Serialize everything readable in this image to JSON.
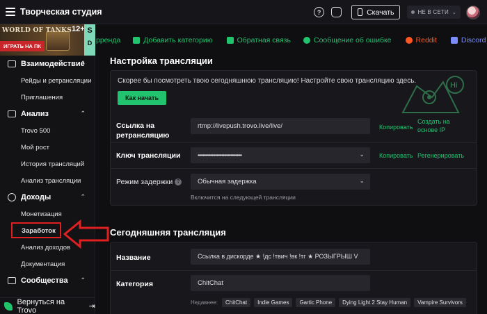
{
  "topbar": {
    "title": "Творческая студия",
    "help_glyph": "?",
    "download_label": "Скачать",
    "status_label": "НЕ В СЕТИ",
    "status_caret": "⌄"
  },
  "promo": {
    "game": "WORLD OF TANKS",
    "play_label": "ИГРАТЬ НА ПК",
    "age": "12+",
    "side_letters": [
      "S",
      "D"
    ]
  },
  "sidebar": {
    "caret_glyph": "⌃",
    "sections": [
      {
        "label": "Взаимодействие",
        "items": [
          "Рейды и ретрансляции",
          "Приглашения"
        ]
      },
      {
        "label": "Анализ",
        "items": [
          "Trovo 500",
          "Мой рост",
          "История трансляций",
          "Анализ трансляции"
        ]
      },
      {
        "label": "Доходы",
        "items": [
          "Монетизация",
          "Заработок",
          "Анализ доходов",
          "Документация"
        ]
      },
      {
        "label": "Сообщества",
        "items": []
      }
    ],
    "back_label": "Вернуться на Trovo",
    "back_glyph": "⇥"
  },
  "links": [
    {
      "label": "рренда",
      "color": "#22c36e"
    },
    {
      "label": "Добавить категорию",
      "color": "#22c36e"
    },
    {
      "label": "Обратная связь",
      "color": "#22c36e"
    },
    {
      "label": "Сообщение об ошибке",
      "color": "#22c36e"
    },
    {
      "label": "Reddit",
      "color": "#ff5722"
    },
    {
      "label": "Discord",
      "color": "#7b8cff"
    }
  ],
  "setup": {
    "heading": "Настройка трансляции",
    "hint": "Скорее бы посмотреть твою сегодняшнюю трансляцию! Настройте свою трансляцию здесь.",
    "start_label": "Как начать",
    "mascot_text": "Hi",
    "rtmp_label": "Ссылка на ретрансляцию",
    "rtmp_value": "rtmp://livepush.trovo.live/live/",
    "rtmp_copy": "Копировать",
    "rtmp_create": "Создать на основе IP",
    "key_label": "Ключ трансляции",
    "key_value": "•••••••••••••••••••••••••••••••••••",
    "key_copy": "Копировать",
    "key_regen": "Регенерировать",
    "delay_label": "Режим задержки",
    "delay_info_glyph": "?",
    "delay_value": "Обычная задержка",
    "delay_note": "Включится на следующей трансляции",
    "dropdown_glyph": "⌄"
  },
  "today": {
    "heading": "Сегодняшняя трансляция",
    "name_label": "Название",
    "name_value": "Ссылка в дискорде ★ !дс !твич !вк !тг ★ РОЗЫГРЫШ V",
    "category_label": "Категория",
    "category_value": "ChitChat",
    "recent_label": "Недавнее:",
    "recent": [
      "ChitChat",
      "Indie Games",
      "Gartic Phone",
      "Dying Light 2 Stay Human",
      "Vampire Survivors"
    ]
  },
  "colors": {
    "accent_green": "#22c36e",
    "annotation_red": "#e02020"
  }
}
